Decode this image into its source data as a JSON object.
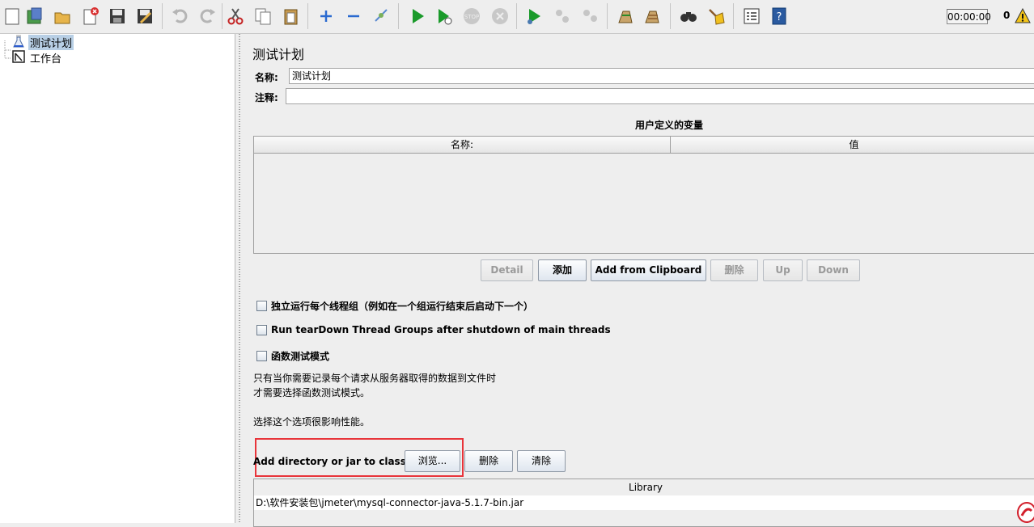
{
  "toolbar": {
    "timer": "00:00:00",
    "error_count": "0",
    "icons": [
      "new-icon",
      "templates-icon",
      "open-icon",
      "close-icon",
      "save-icon",
      "save-as-icon",
      "undo-icon",
      "redo-icon",
      "cut-icon",
      "copy-icon",
      "paste-icon",
      "expand-icon",
      "collapse-icon",
      "toggle-icon",
      "start-icon",
      "start-no-pause-icon",
      "stop-icon",
      "shutdown-icon",
      "remote-start-icon",
      "remote-stop-icon",
      "remote-shutdown-icon",
      "clear-icon",
      "clear-all-icon",
      "search-icon",
      "reset-search-icon",
      "function-helper-icon",
      "help-icon"
    ]
  },
  "tree": {
    "items": [
      {
        "label": "测试计划",
        "icon": "test-plan-icon",
        "selected": true
      },
      {
        "label": "工作台",
        "icon": "workbench-icon",
        "selected": false
      }
    ]
  },
  "panel": {
    "title": "测试计划",
    "name_label": "名称:",
    "name_value": "测试计划",
    "comment_label": "注释:",
    "comment_value": "",
    "vars_title": "用户定义的变量",
    "vars_columns": [
      "名称:",
      "值"
    ],
    "buttons": {
      "detail": "Detail",
      "add": "添加",
      "add_clipboard": "Add from Clipboard",
      "delete": "删除",
      "up": "Up",
      "down": "Down"
    },
    "checkboxes": [
      "独立运行每个线程组（例如在一个组运行结束后启动下一个）",
      "Run tearDown Thread Groups after shutdown of main threads",
      "函数测试模式"
    ],
    "notes": [
      "只有当你需要记录每个请求从服务器取得的数据到文件时",
      "才需要选择函数测试模式。",
      "选择这个选项很影响性能。"
    ],
    "classpath_label": "Add directory or jar to classpath",
    "classpath_buttons": {
      "browse": "浏览...",
      "delete": "删除",
      "clear": "清除"
    },
    "library_header": "Library",
    "library_rows": [
      "D:\\软件安装包\\jmeter\\mysql-connector-java-5.1.7-bin.jar"
    ]
  },
  "colors": {
    "highlight": "#e8343a",
    "selection": "#b8cfe5",
    "background": "#eeeeee"
  }
}
